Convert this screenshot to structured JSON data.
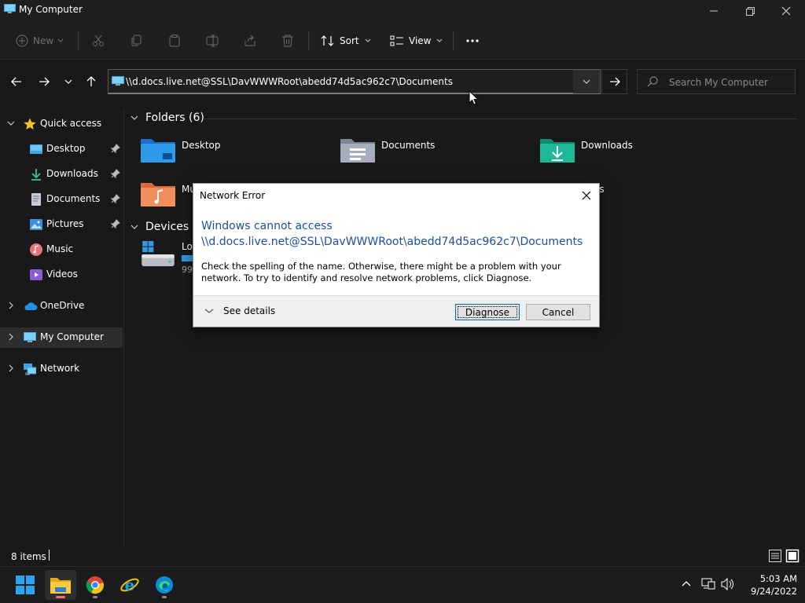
{
  "window": {
    "title": "My Computer"
  },
  "command_bar": {
    "new_label": "New",
    "sort_label": "Sort",
    "view_label": "View"
  },
  "address_bar": {
    "path": "\\\\d.docs.live.net@SSL\\DavWWWRoot\\abedd74d5ac962c7\\Documents",
    "search_placeholder": "Search My Computer"
  },
  "sidebar": {
    "quick_access": "Quick access",
    "items": [
      {
        "label": "Desktop"
      },
      {
        "label": "Downloads"
      },
      {
        "label": "Documents"
      },
      {
        "label": "Pictures"
      },
      {
        "label": "Music"
      },
      {
        "label": "Videos"
      }
    ],
    "onedrive": "OneDrive",
    "my_computer": "My Computer",
    "network": "Network"
  },
  "content": {
    "folders_header": "Folders (6)",
    "folders": [
      {
        "name": "Desktop"
      },
      {
        "name": "Documents"
      },
      {
        "name": "Downloads"
      },
      {
        "name": "Mu"
      },
      {
        "name": "os"
      }
    ],
    "devices_header": "Devices a",
    "drive_label": "Lo",
    "drive_sub": "99"
  },
  "dialog": {
    "title": "Network Error",
    "heading_line1": "Windows cannot access",
    "heading_line2": "\\\\d.docs.live.net@SSL\\DavWWWRoot\\abedd74d5ac962c7\\Documents",
    "body": "Check the spelling of the name. Otherwise, there might be a problem with your network. To try to identify and resolve network problems, click Diagnose.",
    "see_details": "See details",
    "diagnose_label": "Diagnose",
    "cancel_label": "Cancel"
  },
  "status_bar": {
    "item_count": "8 items"
  },
  "taskbar": {
    "time": "5:03 AM",
    "date": "9/24/2022"
  },
  "colors": {
    "accent": "#0067c0",
    "dialog_heading": "#1e4e9a",
    "dark_bg": "#191919"
  }
}
